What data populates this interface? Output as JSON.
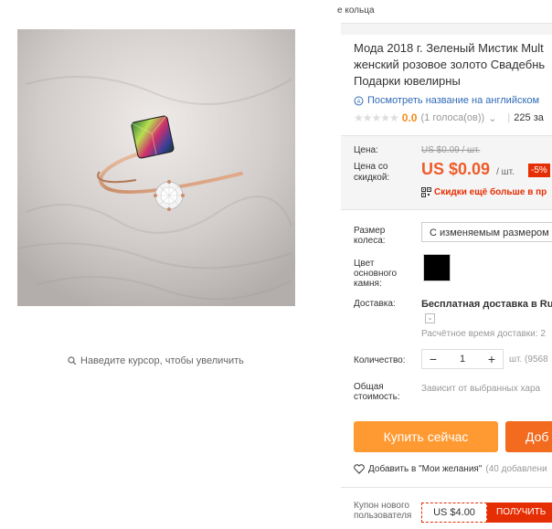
{
  "breadcrumb": "е кольца",
  "product": {
    "title_lines": [
      "Мода 2018 г. Зеленый Мистик Mult",
      "женский розовое золото Свадебнь",
      "Подарки ювелирны"
    ],
    "english_link": "Посмотреть название на английском",
    "rating": {
      "value": "0.0",
      "votes": "(1 голоса(ов))",
      "orders": "225 за"
    }
  },
  "price": {
    "old_label": "Цена:",
    "old_value": "US $0.09 / шт.",
    "discount_label": "Цена со скидкой:",
    "new_value": "US $0.09",
    "unit": "/ шт.",
    "discount_badge": "-5%",
    "app_promo": "Скидки ещё больше в пр"
  },
  "options": {
    "size_label": "Размер колеса:",
    "size_value": "С изменяемым размером",
    "stone_label": "Цвет основного камня:",
    "stone_color": "#000000"
  },
  "shipping": {
    "label": "Доставка:",
    "value": "Бесплатная доставка в Rus",
    "time": "Расчётное время доставки: 2"
  },
  "quantity": {
    "label": "Количество:",
    "minus": "−",
    "value": "1",
    "plus": "+",
    "unit": "шт. (9568"
  },
  "total": {
    "label": "Общая стоимость:",
    "value": "Зависит от выбранных хара"
  },
  "actions": {
    "buy_now": "Купить сейчас",
    "add_to_cart": "Доб"
  },
  "wishlist": {
    "label": "Добавить в \"Мои желания\"",
    "count": "(40 добавлени"
  },
  "coupon": {
    "label": "Купон нового пользователя",
    "amount": "US $4.00",
    "button": "ПОЛУЧИТЬ"
  },
  "gallery": {
    "zoom_hint": "Наведите курсор, чтобы увеличить"
  },
  "colors": {
    "price": "#f05a28",
    "buy": "#ff9a33",
    "cart": "#f26b1f",
    "badge": "#e62e04",
    "link": "#2f6bb8"
  }
}
